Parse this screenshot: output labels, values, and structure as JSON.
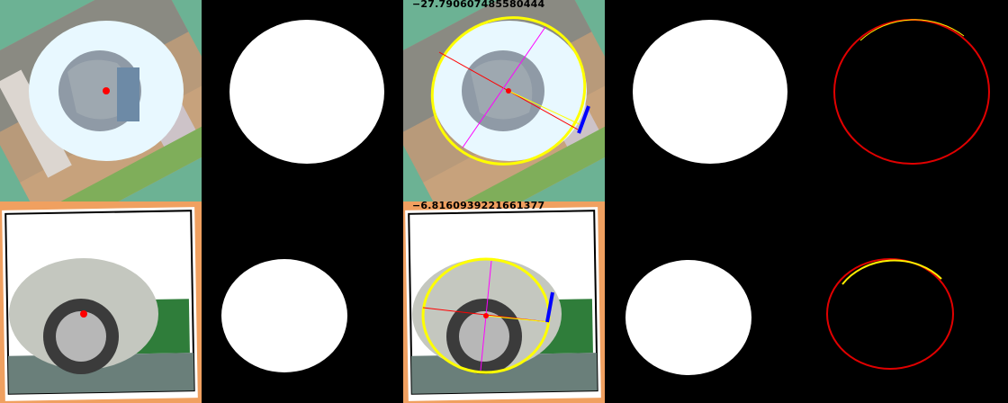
{
  "rows": [
    {
      "angle_value": "−27.790607485580444",
      "signs": [
        "+",
        "+",
        "+",
        "+",
        "+"
      ],
      "scene": "baseball player",
      "background_color": "#6cb294"
    },
    {
      "angle_value": "−6.8160939221661377",
      "signs": [
        "−",
        "−",
        "+",
        "+",
        "+"
      ],
      "scene": "motorcycle wheel",
      "background_color": "#f0a060"
    }
  ],
  "colors": {
    "ring_fill": "#e8f8ff",
    "ellipse_outline": "#ffff00",
    "major_axis": "#ff0000",
    "minor_axis": "#ff00ff",
    "center_dot": "#ff0000",
    "tangent_marker": "#0000ff",
    "sign_color": "#4fe3e3",
    "mask_fill": "#ffffff",
    "background": "#000000"
  }
}
